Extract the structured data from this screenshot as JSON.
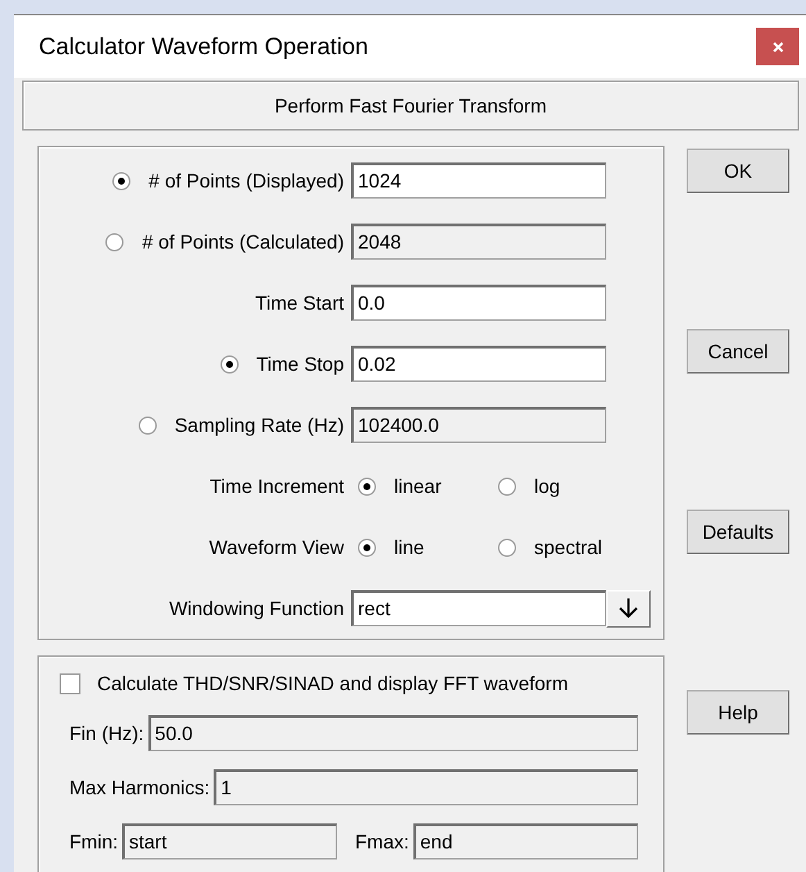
{
  "window": {
    "title": "Calculator Waveform Operation"
  },
  "header": "Perform Fast Fourier Transform",
  "fields": [
    {
      "kind": "radio-field",
      "label": "# of Points (Displayed)",
      "selected": true,
      "value": "1024",
      "editable": true
    },
    {
      "kind": "radio-field",
      "label": "# of Points (Calculated)",
      "selected": false,
      "value": "2048",
      "editable": false
    },
    {
      "kind": "field",
      "label": "Time Start",
      "value": "0.0",
      "editable": true
    },
    {
      "kind": "radio-field",
      "label": "Time Stop",
      "selected": true,
      "value": "0.02",
      "editable": true
    },
    {
      "kind": "radio-field",
      "label": "Sampling Rate (Hz)",
      "selected": false,
      "value": "102400.0",
      "editable": false
    },
    {
      "kind": "options",
      "label": "Time Increment",
      "options": [
        {
          "label": "linear",
          "selected": true
        },
        {
          "label": "log",
          "selected": false
        }
      ]
    },
    {
      "kind": "options",
      "label": "Waveform View",
      "options": [
        {
          "label": "line",
          "selected": true
        },
        {
          "label": "spectral",
          "selected": false
        }
      ]
    },
    {
      "kind": "dropdown",
      "label": "Windowing Function",
      "value": "rect"
    }
  ],
  "buttons": [
    "OK",
    "Cancel",
    "Defaults",
    "Help"
  ],
  "thd": {
    "checkbox": {
      "label": "Calculate THD/SNR/SINAD and display FFT waveform",
      "checked": false
    },
    "fin": {
      "label": "Fin (Hz):",
      "value": "50.0"
    },
    "max_harmonics": {
      "label": "Max Harmonics:",
      "value": "1"
    },
    "fmin": {
      "label": "Fmin:",
      "value": "start"
    },
    "fmax": {
      "label": "Fmax:",
      "value": "end"
    }
  }
}
